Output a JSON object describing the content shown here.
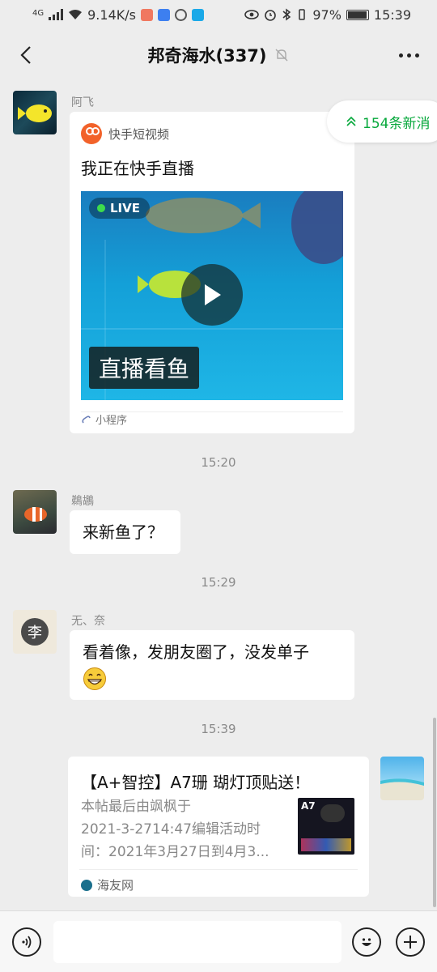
{
  "status_bar": {
    "network": "4G",
    "speed": "9.14K/s",
    "battery": "97%",
    "time": "15:39"
  },
  "header": {
    "title": "邦奇海水(337)",
    "icons": [
      "back-icon",
      "mute-bell-icon",
      "more-icon"
    ]
  },
  "new_messages_pill": "154条新消",
  "messages": [
    {
      "sender": "阿飞",
      "type": "mini-program-card",
      "app_name": "快手短视频",
      "card_title": "我正在快手直播",
      "live_badge": "LIVE",
      "image_caption": "直播看鱼",
      "footer": "小程序"
    },
    {
      "type": "time",
      "text": "15:20"
    },
    {
      "sender": "鵜鶘",
      "type": "text",
      "text": "来新鱼了？"
    },
    {
      "type": "time",
      "text": "15:29"
    },
    {
      "sender": "无、奈",
      "type": "text",
      "text": "看着像，发朋友圈了，没发单子",
      "emoji": "grinning-emoji"
    },
    {
      "type": "time",
      "text": "15:39"
    },
    {
      "sender": "self",
      "type": "link-card",
      "title": "【A+智控】A7珊 瑚灯顶贴送！",
      "desc_lines": [
        "本帖最后由飒枫于",
        "2021-3-2714:47编辑活动时",
        "间：2021年3月27日到4月3..."
      ],
      "thumb_label": "A7",
      "source": "海友网"
    }
  ],
  "input_bar": {
    "icons": [
      "voice-icon",
      "emoji-icon",
      "plus-icon"
    ]
  },
  "colors": {
    "accent_green": "#07a83c",
    "background": "#ededed",
    "kuaishou_orange": "#f2622a"
  }
}
